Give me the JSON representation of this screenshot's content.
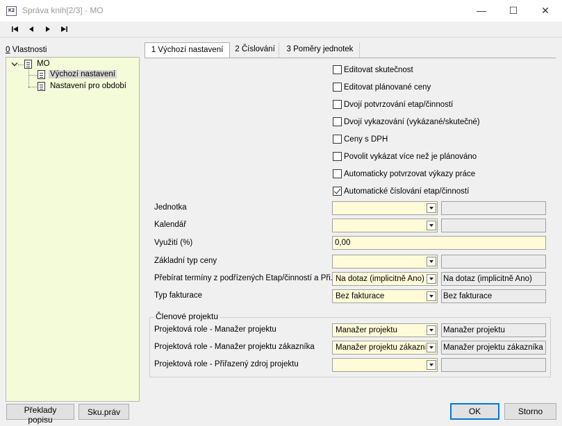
{
  "window": {
    "title": "Správa knih[2/3] - MO",
    "app_icon_text": "K2",
    "minimize_glyph": "—",
    "maximize_glyph": "☐",
    "close_glyph": "✕"
  },
  "navigation": [
    "first-record",
    "previous-record",
    "next-record",
    "last-record"
  ],
  "properties_label_key": "0",
  "properties_label_rest": " Vlastnosti",
  "tree": {
    "root": "MO",
    "children": [
      "Výchozí nastavení",
      "Nastavení pro období"
    ],
    "selected_index": 0
  },
  "tabs": [
    "1 Výchozí nastavení",
    "2 Číslování",
    "3 Poměry jednotek"
  ],
  "checkboxes": [
    {
      "label": "Editovat skutečnost",
      "checked": false
    },
    {
      "label": "Editovat plánované ceny",
      "checked": false
    },
    {
      "label": "Dvojí potvrzování etap/činností",
      "checked": false
    },
    {
      "label": "Dvojí vykazování (vykázané/skutečné)",
      "checked": false
    },
    {
      "label": "Ceny s DPH",
      "checked": false
    },
    {
      "label": "Povolit vykázat více než je plánováno",
      "checked": false
    },
    {
      "label": "Automaticky potvrzovat výkazy práce",
      "checked": false
    },
    {
      "label": "Automatické číslování etap/činností",
      "checked": true
    }
  ],
  "form": {
    "jednotka": {
      "label": "Jednotka",
      "value": "",
      "readonly": ""
    },
    "kalendar": {
      "label": "Kalendář",
      "value": "",
      "readonly": ""
    },
    "vyuziti": {
      "label": "Využití (%)",
      "value": "0,00"
    },
    "typ_ceny": {
      "label": "Základní typ ceny",
      "value": "",
      "readonly": ""
    },
    "terminy": {
      "label": "Přebírat termíny z podřízených Etap/činností a Při...",
      "value": "Na dotaz (implicitně Ano)",
      "readonly": "Na dotaz (implicitně Ano)"
    },
    "fakturace": {
      "label": "Typ fakturace",
      "value": "Bez fakturace",
      "readonly": "Bez fakturace"
    }
  },
  "group": {
    "title": "Členové projektu",
    "manazer": {
      "label": "Projektová role - Manažer projektu",
      "value": "Manažer projektu",
      "readonly": "Manažer projektu"
    },
    "manazer_zak": {
      "label": "Projektová role - Manažer projektu zákazníka",
      "value": "Manažer projektu zákazníka",
      "readonly": "Manažer projektu zákazníka"
    },
    "zdroj": {
      "label": "Projektová role - Přiřazený zdroj projektu",
      "value": "",
      "readonly": ""
    }
  },
  "buttons": {
    "preklady": "Překlady popisu",
    "sku_prav": "Sku.práv",
    "ok": "OK",
    "storno": "Storno"
  }
}
